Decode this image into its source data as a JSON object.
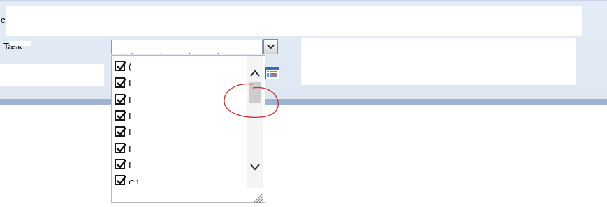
{
  "form": {
    "top_label": "c",
    "task_label": "Task"
  },
  "dropdown": {
    "selected_text": ". . . . . . .",
    "items": [
      {
        "label": "(",
        "checked": true
      },
      {
        "label": "I",
        "checked": true
      },
      {
        "label": "I",
        "checked": true
      },
      {
        "label": "I",
        "checked": true
      },
      {
        "label": "I",
        "checked": true
      },
      {
        "label": "I",
        "checked": true
      },
      {
        "label": "I",
        "checked": true
      },
      {
        "label": "C1",
        "checked": true
      }
    ]
  },
  "icons": {
    "dropdown_toggle": "chevron-down-icon",
    "date_picker": "calendar-icon",
    "scroll_up": "chevron-up-icon",
    "scroll_down": "chevron-down-icon",
    "resize": "resize-grip-icon"
  },
  "colors": {
    "header_bg": "#dfe7f3",
    "band": "#9eb2d4",
    "annotation": "#d9262c"
  }
}
